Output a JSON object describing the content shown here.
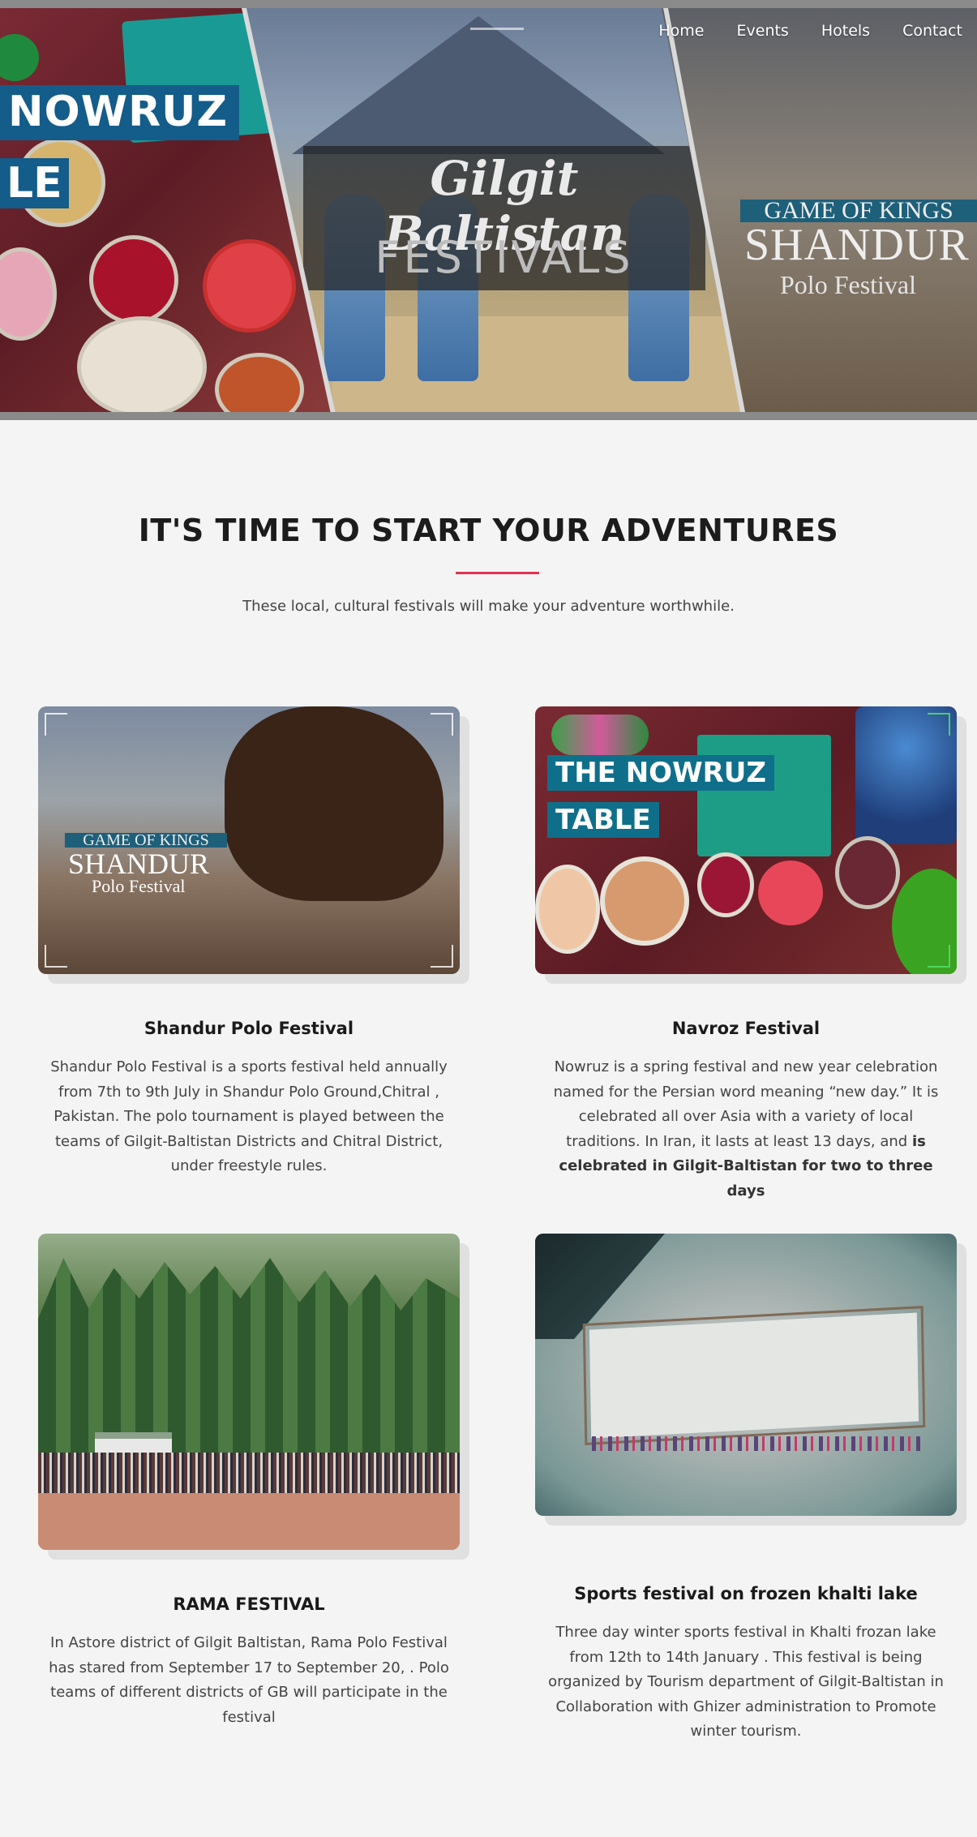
{
  "nav": {
    "items": [
      "Home",
      "Events",
      "Hotels",
      "Contact"
    ]
  },
  "hero": {
    "left_banner_1": "NOWRUZ",
    "left_banner_2": "LE",
    "title": "Gilgit Baltistan",
    "subtitle": "FESTIVALS",
    "right_kicker": "GAME OF KINGS",
    "right_title": "SHANDUR",
    "right_sub": "Polo Festival"
  },
  "section": {
    "title": "IT'S TIME TO START YOUR ADVENTURES",
    "subtitle": "These local, cultural festivals will make your adventure worthwhile.",
    "accent_color": "#e4324e"
  },
  "cards": [
    {
      "title": "Shandur Polo Festival",
      "text": "Shandur Polo Festival is a sports festival held annually from 7th to 9th July in Shandur Polo Ground,Chitral , Pakistan. The polo tournament is played between the teams of Gilgit-Baltistan Districts and Chitral District, under freestyle rules.",
      "image_overlay": {
        "kicker": "GAME OF KINGS",
        "title": "SHANDUR",
        "sub": "Polo Festival"
      }
    },
    {
      "title": "Navroz Festival",
      "text_plain": "Nowruz is a spring festival and new year celebration named for the Persian word meaning “new day.” It is celebrated all over Asia with a variety of local traditions. In Iran, it lasts at least 13 days, and ",
      "text_bold": "is celebrated in Gilgit-Baltistan for two to three days",
      "image_overlay": {
        "line1": "THE NOWRUZ",
        "line2": "TABLE"
      }
    },
    {
      "title": "RAMA FESTIVAL",
      "text": "In Astore district of Gilgit Baltistan, Rama Polo Festival has stared from September 17 to September 20, . Polo teams of different districts of GB will participate in the festival"
    },
    {
      "title": "Sports festival on frozen khalti lake",
      "text": "Three day winter sports festival in Khalti frozan lake from 12th to 14th January . This festival is being organized by Tourism department of Gilgit-Baltistan in Collaboration with Ghizer administration to Promote winter tourism."
    }
  ]
}
